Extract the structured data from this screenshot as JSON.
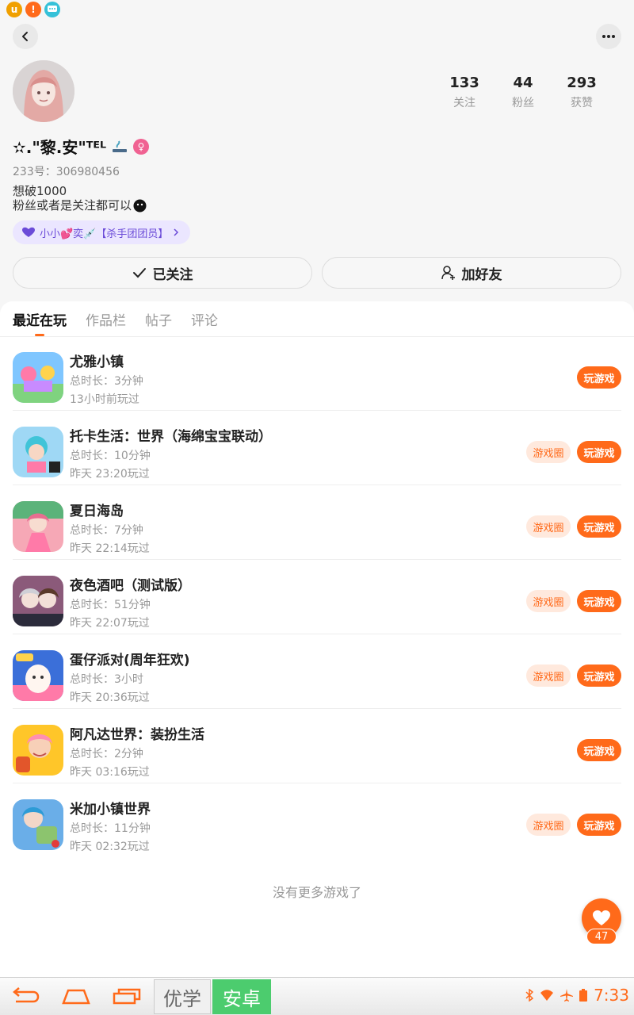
{
  "status_bar": {
    "icons": [
      "u-app-icon",
      "alert-icon",
      "chat-icon"
    ],
    "u_label": "u",
    "alert_label": "!"
  },
  "header": {
    "back_icon": "back-icon",
    "more_icon": "more-icon"
  },
  "profile": {
    "nickname": "✫.\"黎.安\"ᵀᴱᴸ",
    "uid": "233号：306980456",
    "bio_line1": "想破1000",
    "bio_line2": "粉丝或者是关注都可以",
    "badge": "小小💕奕💉【杀手团团员】",
    "stats": [
      {
        "num": "133",
        "label": "关注"
      },
      {
        "num": "44",
        "label": "粉丝"
      },
      {
        "num": "293",
        "label": "获赞"
      }
    ],
    "follow_btn": "已关注",
    "add_friend_btn": "加好友"
  },
  "tabs": [
    "最近在玩",
    "作品栏",
    "帖子",
    "评论"
  ],
  "games": [
    {
      "title": "尤雅小镇",
      "duration": "总时长：3分钟",
      "last": "13小时前玩过",
      "circle": "",
      "play": "玩游戏",
      "color": "#7fc6ff"
    },
    {
      "title": "托卡生活：世界（海绵宝宝联动）",
      "duration": "总时长：10分钟",
      "last": "昨天 23:20玩过",
      "circle": "游戏圈",
      "play": "玩游戏",
      "color": "#9fd8f5"
    },
    {
      "title": "夏日海岛",
      "duration": "总时长：7分钟",
      "last": "昨天 22:14玩过",
      "circle": "游戏圈",
      "play": "玩游戏",
      "color": "#f6a8b6"
    },
    {
      "title": "夜色酒吧（测试版）",
      "duration": "总时长：51分钟",
      "last": "昨天 22:07玩过",
      "circle": "游戏圈",
      "play": "玩游戏",
      "color": "#8b5a7a"
    },
    {
      "title": "蛋仔派对(周年狂欢)",
      "duration": "总时长：3小时",
      "last": "昨天 20:36玩过",
      "circle": "游戏圈",
      "play": "玩游戏",
      "color": "#3b6fd9"
    },
    {
      "title": "阿凡达世界：装扮生活",
      "duration": "总时长：2分钟",
      "last": "昨天 03:16玩过",
      "circle": "",
      "play": "玩游戏",
      "color": "#ffc629"
    },
    {
      "title": "米加小镇世界",
      "duration": "总时长：11分钟",
      "last": "昨天 02:32玩过",
      "circle": "游戏圈",
      "play": "玩游戏",
      "color": "#6aaee8"
    }
  ],
  "no_more": "没有更多游戏了",
  "like_count": "47",
  "nav": {
    "ime_1": "优学",
    "ime_2": "安卓",
    "time": "7:33"
  },
  "colors": {
    "accent": "#ff6a1a",
    "badge_bg": "#ebe6ff",
    "badge_text": "#6b4bd8"
  }
}
